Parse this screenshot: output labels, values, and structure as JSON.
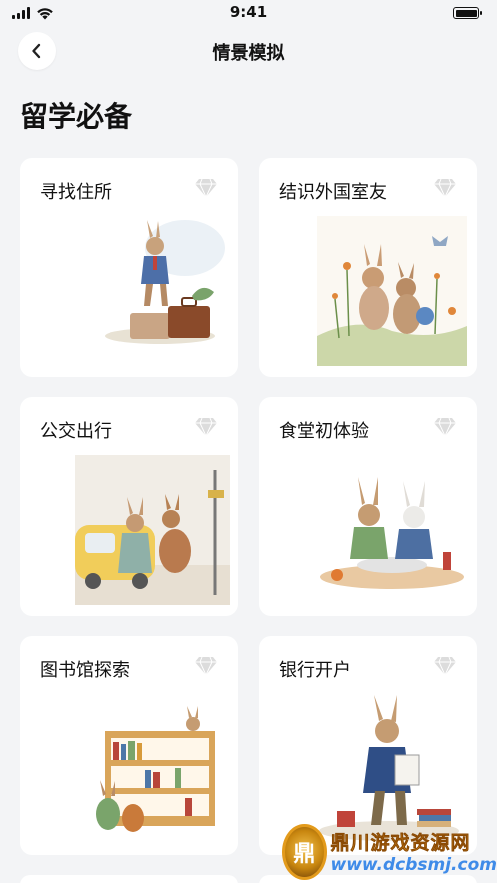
{
  "status": {
    "time": "9:41"
  },
  "nav": {
    "title": "情景模拟"
  },
  "section": {
    "title": "留学必备"
  },
  "cards": [
    {
      "title": "寻找住所",
      "icon": "diamond-icon",
      "image": "rabbit-with-suitcases"
    },
    {
      "title": "结识外国室友",
      "icon": "diamond-icon",
      "image": "two-rabbits-in-flowers"
    },
    {
      "title": "公交出行",
      "icon": "diamond-icon",
      "image": "rabbits-by-yellow-bus"
    },
    {
      "title": "食堂初体验",
      "icon": "diamond-icon",
      "image": "rabbits-at-dining-table"
    },
    {
      "title": "图书馆探索",
      "icon": "diamond-icon",
      "image": "rabbits-in-library"
    },
    {
      "title": "银行开户",
      "icon": "diamond-icon",
      "image": "rabbit-with-documents"
    }
  ],
  "watermark": {
    "logo": "鼎",
    "name": "鼎川游戏资源网",
    "url": "www.dcbsmj.com"
  },
  "colors": {
    "background": "#f3f4f6",
    "card": "#ffffff",
    "gem": "#d9d9d9",
    "text": "#111111"
  }
}
